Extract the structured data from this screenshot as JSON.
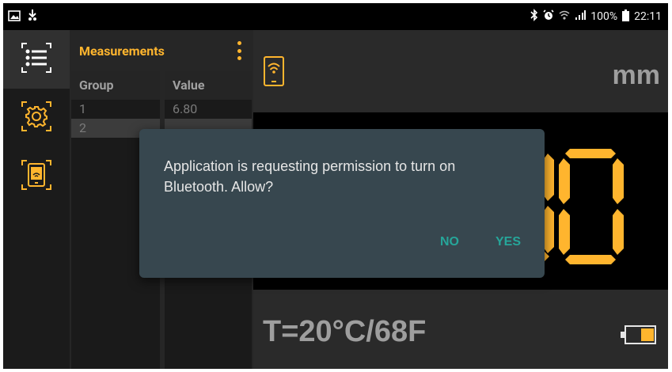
{
  "status_bar": {
    "battery_percent": "100%",
    "time": "22:11",
    "icons": [
      "image-icon",
      "download-icon",
      "bluetooth-icon",
      "alarm-icon",
      "wifi-icon",
      "signal-icon",
      "battery-icon"
    ]
  },
  "nav": {
    "items": [
      {
        "name": "list-icon",
        "active": true
      },
      {
        "name": "settings-icon",
        "active": false
      },
      {
        "name": "device-connect-icon",
        "active": false
      }
    ]
  },
  "table": {
    "title": "Measurements",
    "columns": [
      "Group",
      "Value"
    ],
    "rows": [
      {
        "group": "1",
        "value": "6.80"
      },
      {
        "group": "2",
        "value": ""
      }
    ]
  },
  "display": {
    "unit": "mm",
    "temperature": "T=20°C/68F"
  },
  "dialog": {
    "message": "Application is requesting permission to turn on Bluetooth. Allow?",
    "no_label": "NO",
    "yes_label": "YES"
  },
  "colors": {
    "accent": "#ffb52e",
    "dialog_bg": "#37474f",
    "dialog_button": "#26a69a"
  }
}
